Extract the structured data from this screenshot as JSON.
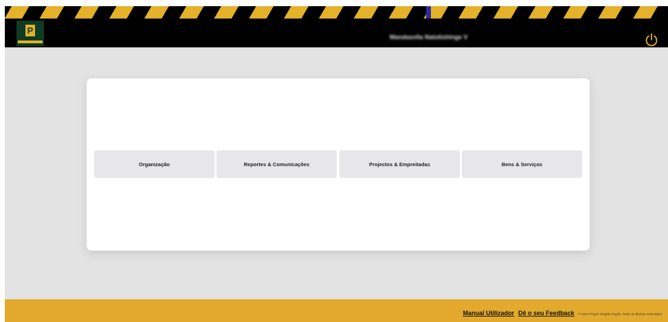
{
  "header": {
    "logo_label": "P",
    "user_name": "Mandasvila Natolishinge V"
  },
  "modules": [
    {
      "label": "Organização"
    },
    {
      "label": "Reportes & Comunicações"
    },
    {
      "label": "Projectos & Empreitadas"
    },
    {
      "label": "Bens & Serviços"
    }
  ],
  "footer": {
    "manual_label": "Manual Utilizador",
    "feedback_label": "Dê o seu Feedback",
    "copyright": "© 2024 Project insights Angola. Todos os direitos reservados."
  },
  "colors": {
    "accent": "#e3b12a",
    "header_bg": "#000000",
    "logo_bg": "#0f3b22",
    "page_bg": "#e3e3e3",
    "button_bg": "#e7e7eb"
  }
}
